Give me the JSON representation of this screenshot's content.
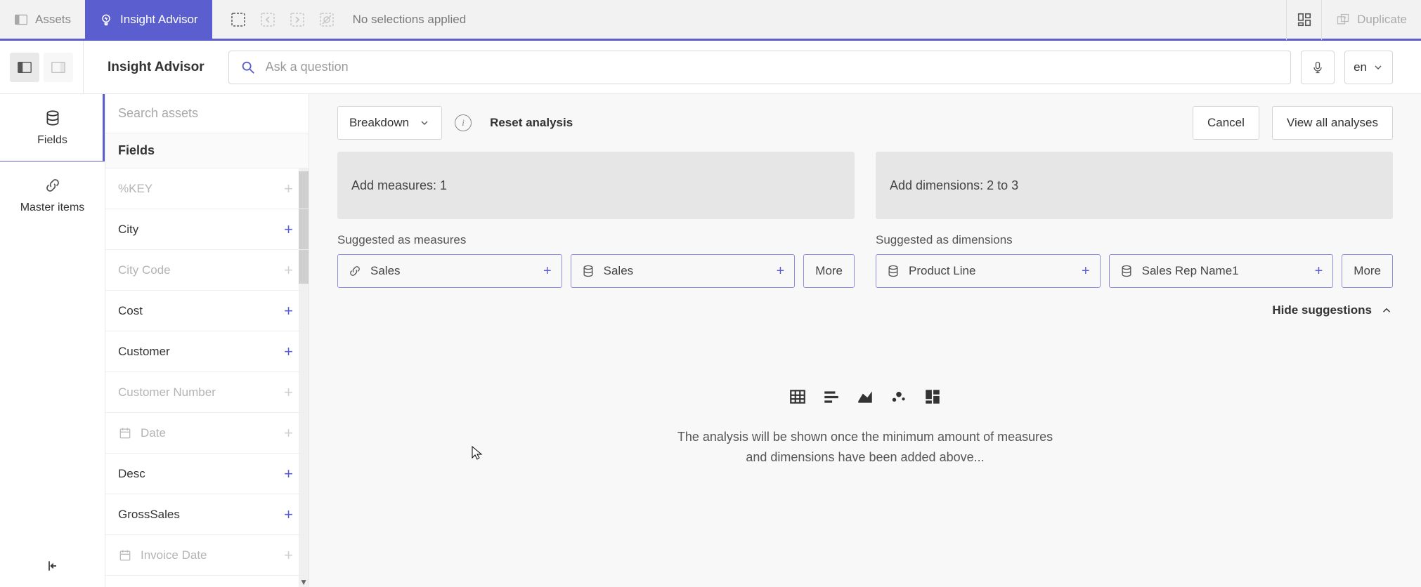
{
  "topbar": {
    "assets_label": "Assets",
    "insight_label": "Insight Advisor",
    "no_selections": "No selections applied",
    "duplicate_label": "Duplicate"
  },
  "subbar": {
    "title": "Insight Advisor",
    "search_placeholder": "Ask a question",
    "lang": "en"
  },
  "leftnav": {
    "fields": "Fields",
    "master_items": "Master items"
  },
  "assets": {
    "search_placeholder": "Search assets",
    "header": "Fields",
    "items": [
      {
        "label": "%KEY",
        "disabled": true,
        "icon": "none"
      },
      {
        "label": "City",
        "disabled": false,
        "icon": "none"
      },
      {
        "label": "City Code",
        "disabled": true,
        "icon": "none"
      },
      {
        "label": "Cost",
        "disabled": false,
        "icon": "none"
      },
      {
        "label": "Customer",
        "disabled": false,
        "icon": "none"
      },
      {
        "label": "Customer Number",
        "disabled": true,
        "icon": "none"
      },
      {
        "label": "Date",
        "disabled": true,
        "icon": "calendar"
      },
      {
        "label": "Desc",
        "disabled": false,
        "icon": "none"
      },
      {
        "label": "GrossSales",
        "disabled": false,
        "icon": "none"
      },
      {
        "label": "Invoice Date",
        "disabled": true,
        "icon": "calendar"
      }
    ]
  },
  "analysis": {
    "dropdown": "Breakdown",
    "reset": "Reset analysis",
    "cancel": "Cancel",
    "view_all": "View all analyses",
    "add_measures": "Add measures: 1",
    "add_dimensions": "Add dimensions: 2 to 3",
    "suggested_measures_label": "Suggested as measures",
    "suggested_dimensions_label": "Suggested as dimensions",
    "more": "More",
    "hide_suggestions": "Hide suggestions",
    "empty_line1": "The analysis will be shown once the minimum amount of measures",
    "empty_line2": "and dimensions have been added above...",
    "measure_chips": [
      {
        "label": "Sales",
        "icon": "link"
      },
      {
        "label": "Sales",
        "icon": "db"
      }
    ],
    "dimension_chips": [
      {
        "label": "Product Line",
        "icon": "db"
      },
      {
        "label": "Sales Rep Name1",
        "icon": "db"
      }
    ]
  }
}
